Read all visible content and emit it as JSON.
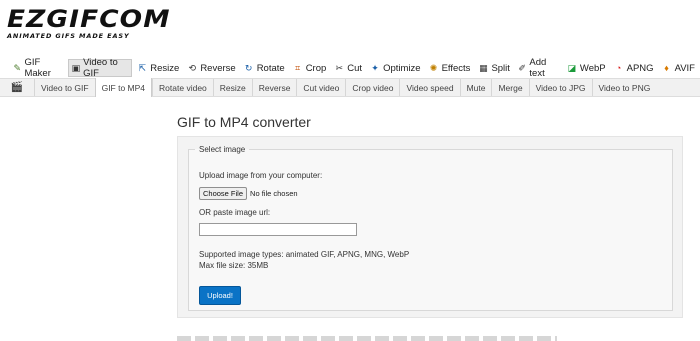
{
  "logo": {
    "name": "EZGIFCOM",
    "tagline": "ANIMATED GIFS MADE EASY"
  },
  "mainnav": [
    {
      "label": "GIF Maker",
      "icon": "gif-maker-icon",
      "active": false
    },
    {
      "label": "Video to GIF",
      "icon": "video-to-gif-icon",
      "active": true
    },
    {
      "label": "Resize",
      "icon": "resize-icon",
      "active": false
    },
    {
      "label": "Reverse",
      "icon": "reverse-icon",
      "active": false
    },
    {
      "label": "Rotate",
      "icon": "rotate-icon",
      "active": false
    },
    {
      "label": "Crop",
      "icon": "crop-icon",
      "active": false
    },
    {
      "label": "Cut",
      "icon": "cut-icon",
      "active": false
    },
    {
      "label": "Optimize",
      "icon": "optimize-icon",
      "active": false
    },
    {
      "label": "Effects",
      "icon": "effects-icon",
      "active": false
    },
    {
      "label": "Split",
      "icon": "split-icon",
      "active": false
    },
    {
      "label": "Add text",
      "icon": "add-text-icon",
      "active": false
    },
    {
      "label": "WebP",
      "icon": "webp-icon",
      "active": false
    },
    {
      "label": "APNG",
      "icon": "apng-icon",
      "active": false
    },
    {
      "label": "AVIF",
      "icon": "avif-icon",
      "active": false
    }
  ],
  "subnav": [
    {
      "label": "Video to GIF",
      "active": false
    },
    {
      "label": "GIF to MP4",
      "active": true
    },
    {
      "label": "Rotate video",
      "active": false
    },
    {
      "label": "Resize",
      "active": false
    },
    {
      "label": "Reverse",
      "active": false
    },
    {
      "label": "Cut video",
      "active": false
    },
    {
      "label": "Crop video",
      "active": false
    },
    {
      "label": "Video speed",
      "active": false
    },
    {
      "label": "Mute",
      "active": false
    },
    {
      "label": "Merge",
      "active": false
    },
    {
      "label": "Video to JPG",
      "active": false
    },
    {
      "label": "Video to PNG",
      "active": false
    }
  ],
  "page": {
    "title": "GIF to MP4 converter"
  },
  "form": {
    "legend": "Select image",
    "upload_label": "Upload image from your computer:",
    "choose_file": "Choose File",
    "no_file": "No file chosen",
    "url_label": "OR paste image url:",
    "url_value": "",
    "supported": "Supported image types: animated GIF, APNG, MNG, WebP",
    "max_size": "Max file size: 35MB",
    "upload_button": "Upload!"
  },
  "colors": {
    "primary_button": "#0a73c6",
    "subnav_bg": "#f1f1f1",
    "panel_bg": "#f3f3f3"
  }
}
